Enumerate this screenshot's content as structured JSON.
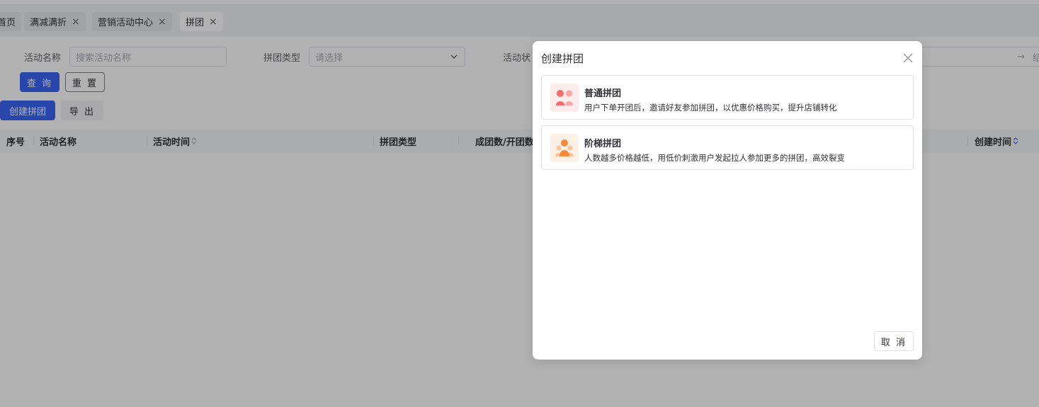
{
  "tabs": [
    {
      "label": "首页",
      "closable": false
    },
    {
      "label": "满减满折",
      "closable": true
    },
    {
      "label": "营销活动中心",
      "closable": true
    },
    {
      "label": "拼团",
      "closable": true,
      "active": true
    }
  ],
  "close_glyph": "×",
  "filters": {
    "activity_name_label": "活动名称",
    "activity_name_placeholder": "搜索活动名称",
    "group_type_label": "拼团类型",
    "group_type_placeholder": "请选择",
    "activity_status_label": "活动状",
    "date_range_separator": "→",
    "date_range_end_placeholder": "结"
  },
  "actions": {
    "query_label": "查 询",
    "reset_label": "重 置",
    "create_label": "创建拼团",
    "export_label": "导 出"
  },
  "table": {
    "columns": [
      "序号",
      "活动名称",
      "活动时间",
      "拼团类型",
      "成团数/开团数",
      "创建时间"
    ]
  },
  "dialog": {
    "title": "创建拼团",
    "options": [
      {
        "title": "普通拼团",
        "desc": "用户下单开团后，邀请好友参加拼团，以优惠价格购买，提升店铺转化",
        "icon": "group-icon",
        "accent": "#f56c6c"
      },
      {
        "title": "阶梯拼团",
        "desc": "人数越多价格越低，用低价刺激用户发起拉人参加更多的拼团，高效裂变",
        "icon": "ladder-group-icon",
        "accent": "#f58a3c"
      }
    ],
    "cancel_label": "取 消"
  },
  "colors": {
    "primary": "#3b66f5",
    "overlay": "rgba(0,0,0,0.30)"
  }
}
